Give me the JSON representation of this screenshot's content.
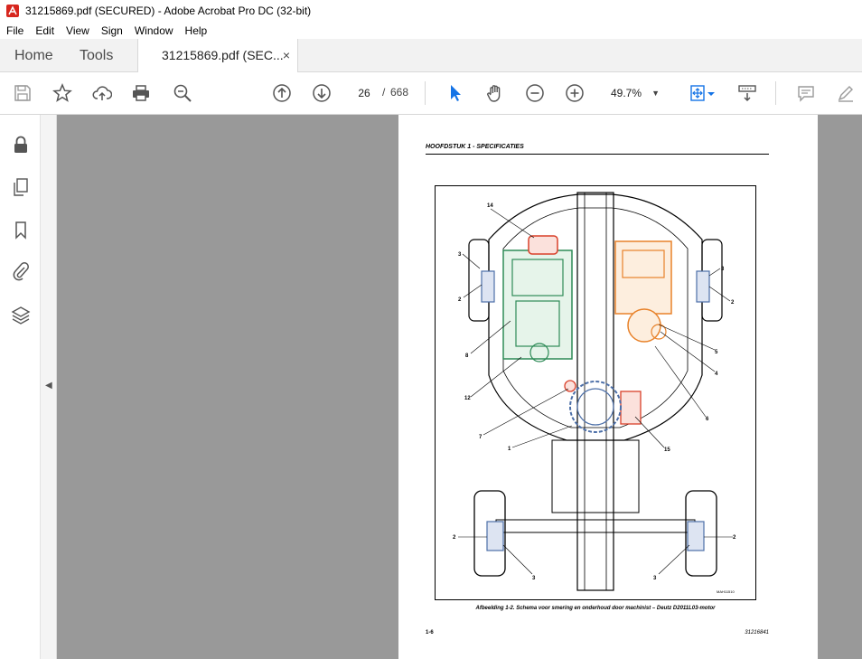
{
  "window": {
    "title": "31215869.pdf (SECURED) - Adobe Acrobat Pro DC (32-bit)"
  },
  "menu": [
    "File",
    "Edit",
    "View",
    "Sign",
    "Window",
    "Help"
  ],
  "tabs": {
    "home": "Home",
    "tools": "Tools",
    "document": "31215869.pdf (SEC...",
    "close": "×"
  },
  "toolbar": {
    "page_current": "26",
    "page_sep": "/",
    "page_total": "668",
    "zoom": "49.7%"
  },
  "document_page": {
    "header": "HOOFDSTUK 1 - SPECIFICATIES",
    "caption": "Afbeelding 1-2. Schema voor smering en onderhoud door machinist – Deutz D2011L03-motor",
    "page_number": "1-6",
    "doc_number": "31216841",
    "drawing_code": "MAH11510",
    "callouts": [
      "14",
      "3",
      "2",
      "8",
      "12",
      "7",
      "1",
      "15",
      "6",
      "4",
      "5",
      "3",
      "2",
      "2",
      "3",
      "2",
      "3"
    ]
  },
  "colors": {
    "accent_blue": "#1473e6",
    "engine_green": "#2e8b57",
    "engine_orange": "#e8822a",
    "engine_red": "#d9402a",
    "part_blue": "#4c6fa8"
  }
}
